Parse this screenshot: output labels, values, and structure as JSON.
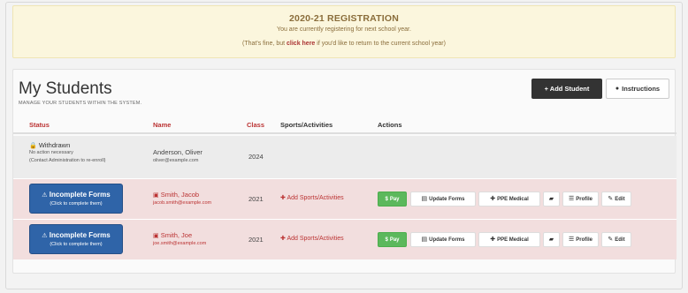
{
  "banner": {
    "title": "2020-21 REGISTRATION",
    "subtitle": "You are currently registering for next school year.",
    "note_prefix": "(That's fine, but ",
    "note_link": "click here",
    "note_suffix": " if you'd like to return to the current school year)"
  },
  "page": {
    "title": "My Students",
    "subtitle": "MANAGE YOUR STUDENTS WITHIN THE SYSTEM."
  },
  "buttons": {
    "add_student": "+ Add Student",
    "instructions": "Instructions"
  },
  "table": {
    "headers": {
      "status": "Status",
      "name": "Name",
      "class": "Class",
      "sports": "Sports/Activities",
      "actions": "Actions"
    },
    "rows": [
      {
        "status_1": "Withdrawn",
        "status_2": "No action necessary",
        "status_3": "(Contact Administration to re-enroll)",
        "name": "Anderson, Oliver",
        "email": "oliver@example.com",
        "class": "2024"
      },
      {
        "status_btn_1": "Incomplete Forms",
        "status_btn_2": "(Click to complete them)",
        "name": "Smith, Jacob",
        "email": "jacob.smith@example.com",
        "class": "2021",
        "sports": "Add Sports/Activities"
      },
      {
        "status_btn_1": "Incomplete Forms",
        "status_btn_2": "(Click to complete them)",
        "name": "Smith, Joe",
        "email": "joe.smith@example.com",
        "class": "2021",
        "sports": "Add Sports/Activities"
      }
    ],
    "actions": {
      "pay": "Pay",
      "update_forms": "Update Forms",
      "ppe_medical": "PPE Medical",
      "profile": "Profile",
      "edit": "Edit"
    }
  },
  "colors": {
    "banner_bg": "#fbf6dd",
    "accent_red": "#b33",
    "incomplete_blue": "#2f64a8",
    "pay_green": "#5cb85c",
    "row_pink": "#f2dede"
  }
}
